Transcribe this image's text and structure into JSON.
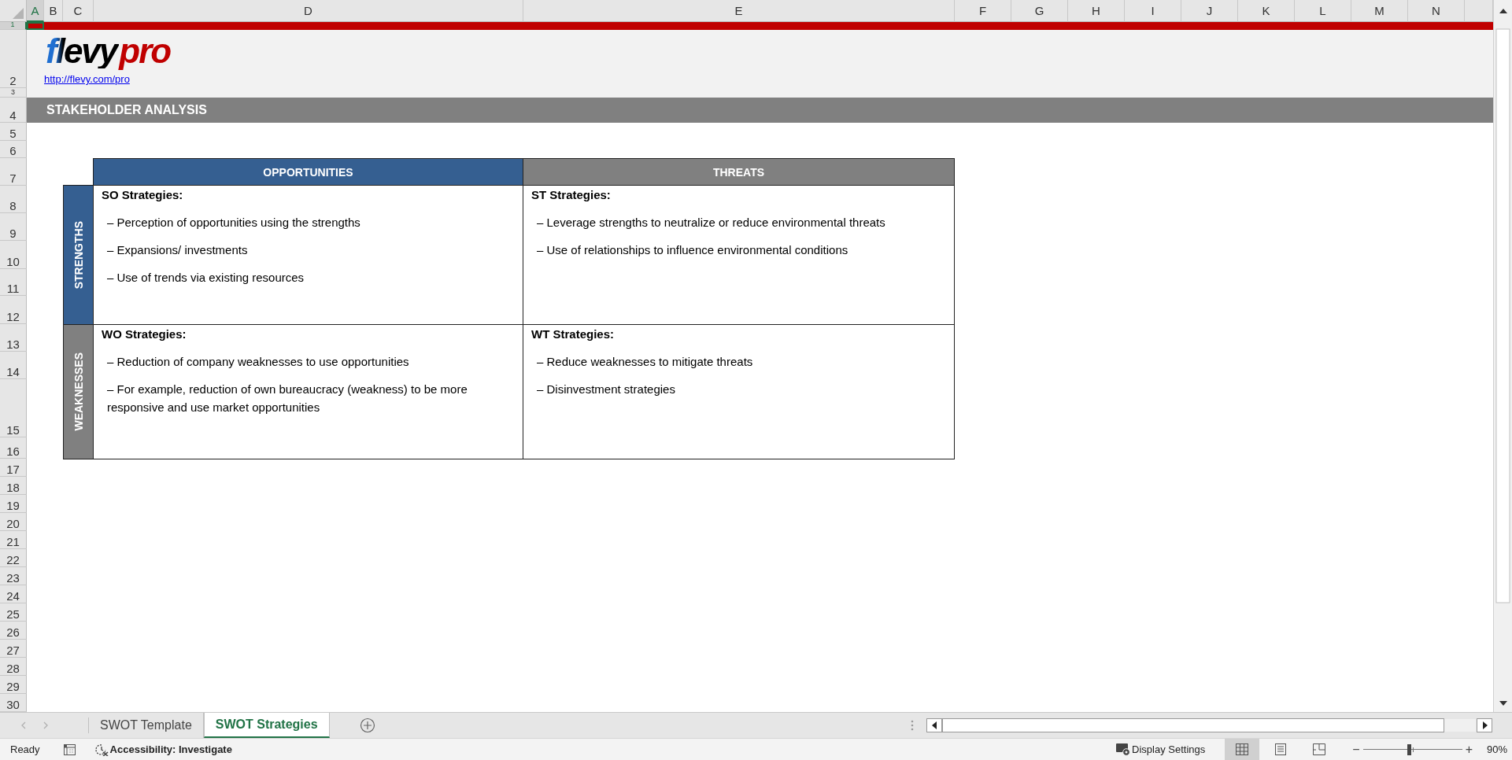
{
  "columns": [
    {
      "label": "A",
      "selected": true
    },
    {
      "label": "B",
      "selected": false
    },
    {
      "label": "C",
      "selected": false
    },
    {
      "label": "D",
      "selected": false
    },
    {
      "label": "E",
      "selected": false
    },
    {
      "label": "F",
      "selected": false
    },
    {
      "label": "G",
      "selected": false
    },
    {
      "label": "H",
      "selected": false
    },
    {
      "label": "I",
      "selected": false
    },
    {
      "label": "J",
      "selected": false
    },
    {
      "label": "K",
      "selected": false
    },
    {
      "label": "L",
      "selected": false
    },
    {
      "label": "M",
      "selected": false
    },
    {
      "label": "N",
      "selected": false
    }
  ],
  "rows": [
    {
      "label": "1",
      "selected": true
    },
    {
      "label": "2",
      "selected": false
    },
    {
      "label": "3",
      "selected": false
    },
    {
      "label": "4",
      "selected": false
    },
    {
      "label": "5",
      "selected": false
    },
    {
      "label": "6",
      "selected": false
    },
    {
      "label": "7",
      "selected": false
    },
    {
      "label": "8",
      "selected": false
    },
    {
      "label": "9",
      "selected": false
    },
    {
      "label": "10",
      "selected": false
    },
    {
      "label": "11",
      "selected": false
    },
    {
      "label": "12",
      "selected": false
    },
    {
      "label": "13",
      "selected": false
    },
    {
      "label": "14",
      "selected": false
    },
    {
      "label": "15",
      "selected": false
    },
    {
      "label": "16",
      "selected": false
    },
    {
      "label": "17",
      "selected": false
    },
    {
      "label": "18",
      "selected": false
    },
    {
      "label": "19",
      "selected": false
    },
    {
      "label": "20",
      "selected": false
    },
    {
      "label": "21",
      "selected": false
    },
    {
      "label": "22",
      "selected": false
    },
    {
      "label": "23",
      "selected": false
    },
    {
      "label": "24",
      "selected": false
    },
    {
      "label": "25",
      "selected": false
    },
    {
      "label": "26",
      "selected": false
    },
    {
      "label": "27",
      "selected": false
    },
    {
      "label": "28",
      "selected": false
    },
    {
      "label": "29",
      "selected": false
    },
    {
      "label": "30",
      "selected": false
    }
  ],
  "logo": {
    "part_1": "flevy",
    "part_2": "pro"
  },
  "link": "http://flevy.com/pro",
  "title_band": "STAKEHOLDER ANALYSIS",
  "matrix": {
    "columns": [
      {
        "label": "OPPORTUNITIES",
        "color": "#355f91"
      },
      {
        "label": "THREATS",
        "color": "#808080"
      }
    ],
    "rows": [
      {
        "label": "STRENGTHS",
        "color": "#355f91",
        "cells": [
          {
            "title": "SO Strategies:",
            "items": [
              "– Perception of opportunities using the strengths",
              "– Expansions/ investments",
              "– Use of trends via existing resources"
            ]
          },
          {
            "title": "ST Strategies:",
            "items": [
              "– Leverage strengths to neutralize or reduce environmental threats",
              "– Use of relationships to influence environmental conditions"
            ]
          }
        ]
      },
      {
        "label": "WEAKNESSES",
        "color": "#808080",
        "cells": [
          {
            "title": "WO Strategies:",
            "items": [
              "– Reduction of company weaknesses to use opportunities",
              "– For example, reduction of own bureaucracy (weakness) to be more responsive and use market opportunities"
            ]
          },
          {
            "title": "WT Strategies:",
            "items": [
              "– Reduce weaknesses to mitigate threats",
              "– Disinvestment strategies"
            ]
          }
        ]
      }
    ]
  },
  "sheet_tabs": [
    {
      "label": "SWOT Template",
      "selected": false
    },
    {
      "label": "SWOT Strategies",
      "selected": true
    }
  ],
  "status_bar": {
    "mode": "Ready",
    "accessibility": "Accessibility: Investigate",
    "display_settings": "Display Settings",
    "view_buttons": [
      {
        "kind": "normal",
        "selected": true
      },
      {
        "kind": "page_layout",
        "selected": false
      },
      {
        "kind": "page_break",
        "selected": false
      }
    ],
    "zoom_minus": "−",
    "zoom_plus": "+",
    "zoom_slider": {
      "level": 0.46
    },
    "zoom": "90%"
  }
}
